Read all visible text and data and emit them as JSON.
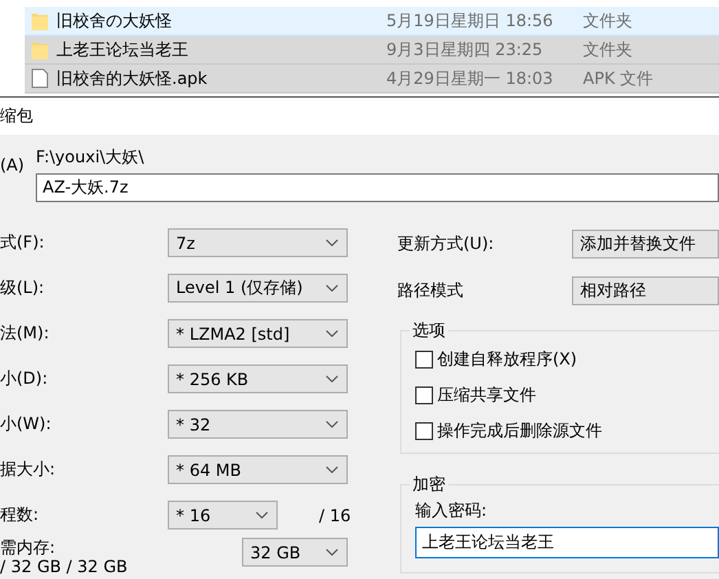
{
  "files": [
    {
      "name": "旧校舍の大妖怪",
      "date": "5月19日星期日 18:56",
      "type": "文件夹",
      "kind": "folder",
      "selected": true
    },
    {
      "name": "上老王论坛当老王",
      "date": "9月3日星期四 23:25",
      "type": "文件夹",
      "kind": "folder",
      "selected": false
    },
    {
      "name": "旧校舍的大妖怪.apk",
      "date": "4月29日星期一 18:03",
      "type": "APK 文件",
      "kind": "file",
      "selected": false
    }
  ],
  "dialog": {
    "title": "缩包",
    "archive": {
      "label": "(A)",
      "path": "F:\\youxi\\大妖\\",
      "value": "AZ-大妖.7z"
    },
    "settings": [
      {
        "label": "式(F):",
        "value": "7z"
      },
      {
        "label": "级(L):",
        "value": "Level 1 (仅存储)"
      },
      {
        "label": "法(M):",
        "value": "* LZMA2 [std]"
      },
      {
        "label": "小(D):",
        "value": "* 256 KB"
      },
      {
        "label": "小(W):",
        "value": "* 32"
      },
      {
        "label": "据大小:",
        "value": "* 64 MB"
      },
      {
        "label": "程数:",
        "value": "* 16",
        "suffix": "/ 16"
      }
    ],
    "memory": {
      "label": "需内存:",
      "usage": "/ 32 GB / 32 GB",
      "value": "32 GB"
    },
    "update": {
      "label": "更新方式(U):",
      "value": "添加并替换文件"
    },
    "path_mode": {
      "label": "路径模式",
      "value": "相对路径"
    },
    "options": {
      "title": "选项",
      "items": [
        {
          "label": "创建自释放程序(X)",
          "checked": false
        },
        {
          "label": "压缩共享文件",
          "checked": false
        },
        {
          "label": "操作完成后删除源文件",
          "checked": false
        }
      ]
    },
    "encryption": {
      "title": "加密",
      "label": "输入密码:",
      "value": "上老王论坛当老王"
    }
  }
}
